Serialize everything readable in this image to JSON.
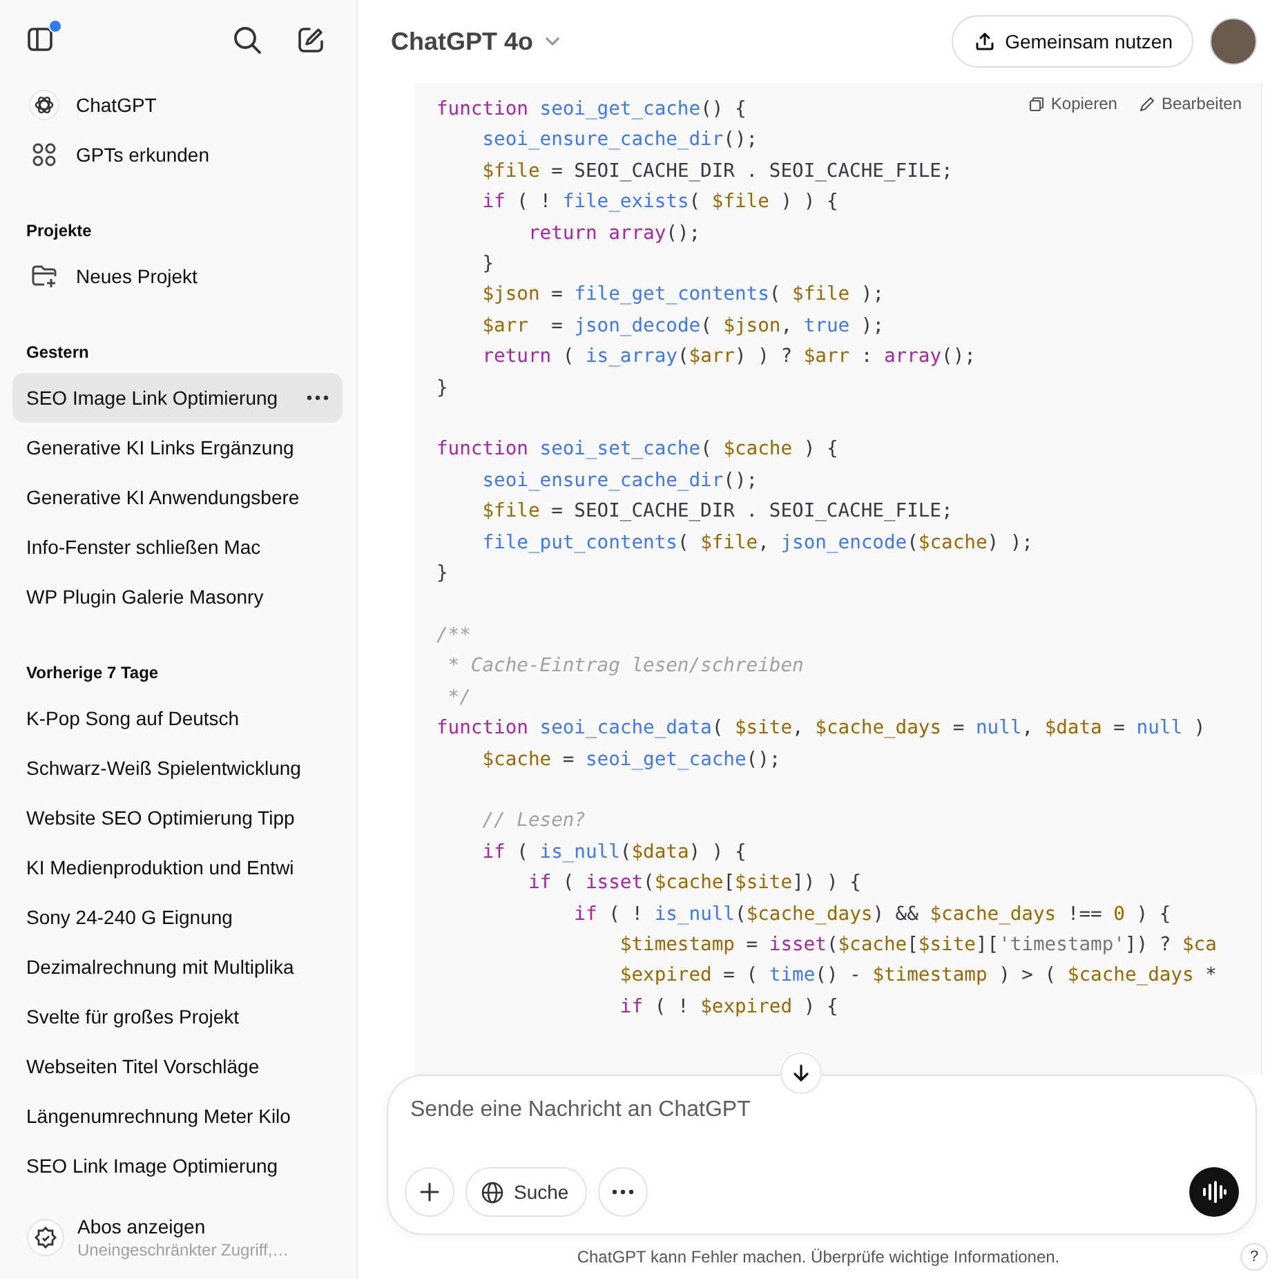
{
  "sidebar": {
    "notification_dot": true,
    "nav": [
      {
        "kind": "logo",
        "label": "ChatGPT"
      },
      {
        "kind": "grid",
        "label": "GPTs erkunden"
      }
    ],
    "projects": {
      "heading": "Projekte",
      "items": [
        {
          "label": "Neues Projekt"
        }
      ]
    },
    "sections": [
      {
        "heading": "Gestern",
        "chats": [
          {
            "label": "SEO Image Link Optimierung",
            "selected": true
          },
          {
            "label": "Generative KI Links Ergänzung",
            "selected": false
          },
          {
            "label": "Generative KI Anwendungsbere",
            "selected": false
          },
          {
            "label": "Info-Fenster schließen Mac",
            "selected": false
          },
          {
            "label": "WP Plugin Galerie Masonry",
            "selected": false
          }
        ]
      },
      {
        "heading": "Vorherige 7 Tage",
        "chats": [
          {
            "label": "K-Pop Song auf Deutsch",
            "selected": false
          },
          {
            "label": "Schwarz-Weiß Spielentwicklung",
            "selected": false
          },
          {
            "label": "Website SEO Optimierung Tipp",
            "selected": false
          },
          {
            "label": "KI Medienproduktion und Entwi",
            "selected": false
          },
          {
            "label": "Sony 24-240 G Eignung",
            "selected": false
          },
          {
            "label": "Dezimalrechnung mit Multiplika",
            "selected": false
          },
          {
            "label": "Svelte für großes Projekt",
            "selected": false
          },
          {
            "label": "Webseiten Titel Vorschläge",
            "selected": false
          },
          {
            "label": "Längenumrechnung Meter Kilo",
            "selected": false
          },
          {
            "label": "SEO Link Image Optimierung",
            "selected": false
          }
        ]
      }
    ],
    "upgrade": {
      "title": "Abos anzeigen",
      "subtitle": "Uneingeschränkter Zugriff,…"
    }
  },
  "header": {
    "model": "ChatGPT 4o",
    "share_button": "Gemeinsam nutzen"
  },
  "code_block": {
    "actions": [
      "Kopieren",
      "Bearbeiten"
    ],
    "lines": [
      {
        "kind": "code",
        "tokens": [
          {
            "kind": "keyword",
            "text": "function"
          },
          {
            "kind": "func",
            "text": " seoi_get_cache"
          },
          {
            "kind": "plain",
            "text": "() {"
          }
        ]
      },
      {
        "kind": "code",
        "tokens": [
          {
            "kind": "func",
            "text": "    seoi_ensure_cache_dir"
          },
          {
            "kind": "plain",
            "text": "();"
          }
        ]
      },
      {
        "kind": "code",
        "tokens": [
          {
            "kind": "var",
            "text": "    $file"
          },
          {
            "kind": "plain",
            "text": " = SEOI_CACHE_DIR . SEOI_CACHE_FILE;"
          }
        ]
      },
      {
        "kind": "code",
        "tokens": [
          {
            "kind": "keyword",
            "text": "    if"
          },
          {
            "kind": "plain",
            "text": " ( ! "
          },
          {
            "kind": "func",
            "text": "file_exists"
          },
          {
            "kind": "plain",
            "text": "( "
          },
          {
            "kind": "var",
            "text": "$file"
          },
          {
            "kind": "plain",
            "text": " ) ) {"
          }
        ]
      },
      {
        "kind": "code",
        "tokens": [
          {
            "kind": "keyword",
            "text": "        return"
          },
          {
            "kind": "keyword",
            "text": " array"
          },
          {
            "kind": "plain",
            "text": "();"
          }
        ]
      },
      {
        "kind": "code",
        "tokens": [
          {
            "kind": "plain",
            "text": "    }"
          }
        ]
      },
      {
        "kind": "code",
        "tokens": [
          {
            "kind": "var",
            "text": "    $json"
          },
          {
            "kind": "plain",
            "text": " = "
          },
          {
            "kind": "func",
            "text": "file_get_contents"
          },
          {
            "kind": "plain",
            "text": "( "
          },
          {
            "kind": "var",
            "text": "$file"
          },
          {
            "kind": "plain",
            "text": " );"
          }
        ]
      },
      {
        "kind": "code",
        "tokens": [
          {
            "kind": "var",
            "text": "    $arr"
          },
          {
            "kind": "plain",
            "text": "  = "
          },
          {
            "kind": "func",
            "text": "json_decode"
          },
          {
            "kind": "plain",
            "text": "( "
          },
          {
            "kind": "var",
            "text": "$json"
          },
          {
            "kind": "plain",
            "text": ", "
          },
          {
            "kind": "literal",
            "text": "true"
          },
          {
            "kind": "plain",
            "text": " );"
          }
        ]
      },
      {
        "kind": "code",
        "tokens": [
          {
            "kind": "keyword",
            "text": "    return"
          },
          {
            "kind": "plain",
            "text": " ( "
          },
          {
            "kind": "func",
            "text": "is_array"
          },
          {
            "kind": "plain",
            "text": "("
          },
          {
            "kind": "var",
            "text": "$arr"
          },
          {
            "kind": "plain",
            "text": ") ) ? "
          },
          {
            "kind": "var",
            "text": "$arr"
          },
          {
            "kind": "plain",
            "text": " : "
          },
          {
            "kind": "keyword",
            "text": "array"
          },
          {
            "kind": "plain",
            "text": "();"
          }
        ]
      },
      {
        "kind": "code",
        "tokens": [
          {
            "kind": "plain",
            "text": "}"
          }
        ]
      },
      {
        "kind": "blank"
      },
      {
        "kind": "code",
        "tokens": [
          {
            "kind": "keyword",
            "text": "function"
          },
          {
            "kind": "func",
            "text": " seoi_set_cache"
          },
          {
            "kind": "plain",
            "text": "( "
          },
          {
            "kind": "var",
            "text": "$cache"
          },
          {
            "kind": "plain",
            "text": " ) {"
          }
        ]
      },
      {
        "kind": "code",
        "tokens": [
          {
            "kind": "func",
            "text": "    seoi_ensure_cache_dir"
          },
          {
            "kind": "plain",
            "text": "();"
          }
        ]
      },
      {
        "kind": "code",
        "tokens": [
          {
            "kind": "var",
            "text": "    $file"
          },
          {
            "kind": "plain",
            "text": " = SEOI_CACHE_DIR . SEOI_CACHE_FILE;"
          }
        ]
      },
      {
        "kind": "code",
        "tokens": [
          {
            "kind": "func",
            "text": "    file_put_contents"
          },
          {
            "kind": "plain",
            "text": "( "
          },
          {
            "kind": "var",
            "text": "$file"
          },
          {
            "kind": "plain",
            "text": ", "
          },
          {
            "kind": "func",
            "text": "json_encode"
          },
          {
            "kind": "plain",
            "text": "("
          },
          {
            "kind": "var",
            "text": "$cache"
          },
          {
            "kind": "plain",
            "text": ") );"
          }
        ]
      },
      {
        "kind": "code",
        "tokens": [
          {
            "kind": "plain",
            "text": "}"
          }
        ]
      },
      {
        "kind": "blank"
      },
      {
        "kind": "code",
        "tokens": [
          {
            "kind": "comment",
            "text": "/**"
          }
        ]
      },
      {
        "kind": "code",
        "tokens": [
          {
            "kind": "comment",
            "text": " * Cache-Eintrag lesen/schreiben"
          }
        ]
      },
      {
        "kind": "code",
        "tokens": [
          {
            "kind": "comment",
            "text": " */"
          }
        ]
      },
      {
        "kind": "code",
        "tokens": [
          {
            "kind": "keyword",
            "text": "function"
          },
          {
            "kind": "func",
            "text": " seoi_cache_data"
          },
          {
            "kind": "plain",
            "text": "( "
          },
          {
            "kind": "var",
            "text": "$site"
          },
          {
            "kind": "plain",
            "text": ", "
          },
          {
            "kind": "var",
            "text": "$cache_days"
          },
          {
            "kind": "plain",
            "text": " = "
          },
          {
            "kind": "literal",
            "text": "null"
          },
          {
            "kind": "plain",
            "text": ", "
          },
          {
            "kind": "var",
            "text": "$data"
          },
          {
            "kind": "plain",
            "text": " = "
          },
          {
            "kind": "literal",
            "text": "null"
          },
          {
            "kind": "plain",
            "text": " )"
          }
        ]
      },
      {
        "kind": "code",
        "tokens": [
          {
            "kind": "var",
            "text": "    $cache"
          },
          {
            "kind": "plain",
            "text": " = "
          },
          {
            "kind": "func",
            "text": "seoi_get_cache"
          },
          {
            "kind": "plain",
            "text": "();"
          }
        ]
      },
      {
        "kind": "blank"
      },
      {
        "kind": "code",
        "tokens": [
          {
            "kind": "comment",
            "text": "    // Lesen?"
          }
        ]
      },
      {
        "kind": "code",
        "tokens": [
          {
            "kind": "keyword",
            "text": "    if"
          },
          {
            "kind": "plain",
            "text": " ( "
          },
          {
            "kind": "func",
            "text": "is_null"
          },
          {
            "kind": "plain",
            "text": "("
          },
          {
            "kind": "var",
            "text": "$data"
          },
          {
            "kind": "plain",
            "text": ") ) {"
          }
        ]
      },
      {
        "kind": "code",
        "tokens": [
          {
            "kind": "keyword",
            "text": "        if"
          },
          {
            "kind": "plain",
            "text": " ( "
          },
          {
            "kind": "keyword",
            "text": "isset"
          },
          {
            "kind": "plain",
            "text": "("
          },
          {
            "kind": "var",
            "text": "$cache"
          },
          {
            "kind": "plain",
            "text": "["
          },
          {
            "kind": "var",
            "text": "$site"
          },
          {
            "kind": "plain",
            "text": "]) ) {"
          }
        ]
      },
      {
        "kind": "code",
        "tokens": [
          {
            "kind": "keyword",
            "text": "            if"
          },
          {
            "kind": "plain",
            "text": " ( ! "
          },
          {
            "kind": "func",
            "text": "is_null"
          },
          {
            "kind": "plain",
            "text": "("
          },
          {
            "kind": "var",
            "text": "$cache_days"
          },
          {
            "kind": "plain",
            "text": ") && "
          },
          {
            "kind": "var",
            "text": "$cache_days"
          },
          {
            "kind": "plain",
            "text": " !== "
          },
          {
            "kind": "var",
            "text": "0"
          },
          {
            "kind": "plain",
            "text": " ) {"
          }
        ]
      },
      {
        "kind": "code",
        "tokens": [
          {
            "kind": "var",
            "text": "                $timestamp"
          },
          {
            "kind": "plain",
            "text": " = "
          },
          {
            "kind": "keyword",
            "text": "isset"
          },
          {
            "kind": "plain",
            "text": "("
          },
          {
            "kind": "var",
            "text": "$cache"
          },
          {
            "kind": "plain",
            "text": "["
          },
          {
            "kind": "var",
            "text": "$site"
          },
          {
            "kind": "plain",
            "text": "]["
          },
          {
            "kind": "string",
            "text": "'timestamp'"
          },
          {
            "kind": "plain",
            "text": "]) ? "
          },
          {
            "kind": "var",
            "text": "$ca"
          }
        ]
      },
      {
        "kind": "code",
        "tokens": [
          {
            "kind": "var",
            "text": "                $expired"
          },
          {
            "kind": "plain",
            "text": " = ( "
          },
          {
            "kind": "func",
            "text": "time"
          },
          {
            "kind": "plain",
            "text": "() - "
          },
          {
            "kind": "var",
            "text": "$timestamp"
          },
          {
            "kind": "plain",
            "text": " ) > ( "
          },
          {
            "kind": "var",
            "text": "$cache_days"
          },
          {
            "kind": "plain",
            "text": " *"
          }
        ]
      },
      {
        "kind": "code",
        "tokens": [
          {
            "kind": "keyword",
            "text": "                if"
          },
          {
            "kind": "plain",
            "text": " ( ! "
          },
          {
            "kind": "var",
            "text": "$expired"
          },
          {
            "kind": "plain",
            "text": " ) {"
          }
        ]
      }
    ]
  },
  "composer": {
    "placeholder": "Sende eine Nachricht an ChatGPT",
    "search_button": "Suche"
  },
  "footer": {
    "disclaimer": "ChatGPT kann Fehler machen. Überprüfe wichtige Informationen.",
    "help": "?"
  }
}
